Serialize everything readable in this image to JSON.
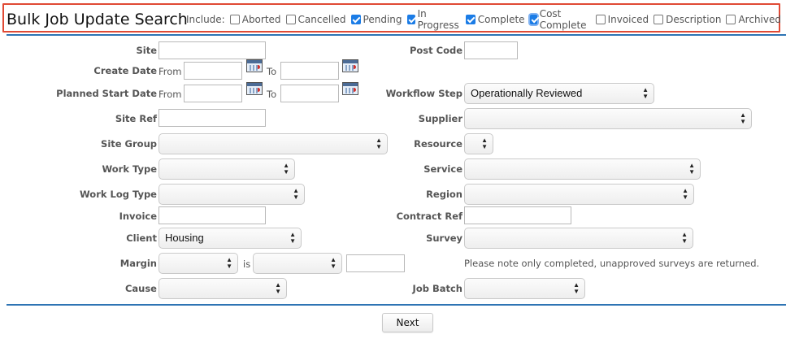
{
  "header": {
    "title": "Bulk Job Update Search",
    "include_label": "Include:",
    "filters": [
      {
        "label": "Aborted",
        "checked": false
      },
      {
        "label": "Cancelled",
        "checked": false
      },
      {
        "label": "Pending",
        "checked": true
      },
      {
        "label": "In Progress",
        "checked": true
      },
      {
        "label": "Complete",
        "checked": true
      },
      {
        "label": "Cost Complete",
        "checked": true
      },
      {
        "label": "Invoiced",
        "checked": false
      },
      {
        "label": "Description",
        "checked": false
      },
      {
        "label": "Archived",
        "checked": false
      }
    ]
  },
  "form": {
    "site": {
      "label": "Site",
      "value": ""
    },
    "post_code": {
      "label": "Post Code",
      "value": ""
    },
    "create_date": {
      "label": "Create Date",
      "from": "From",
      "to": "To",
      "from_value": "",
      "to_value": ""
    },
    "planned_start_date": {
      "label": "Planned Start Date",
      "from": "From",
      "to": "To",
      "from_value": "",
      "to_value": ""
    },
    "workflow_step": {
      "label": "Workflow Step",
      "value": "Operationally Reviewed"
    },
    "site_ref": {
      "label": "Site Ref",
      "value": ""
    },
    "supplier": {
      "label": "Supplier",
      "value": ""
    },
    "site_group": {
      "label": "Site Group",
      "value": ""
    },
    "resource": {
      "label": "Resource",
      "value": ""
    },
    "work_type": {
      "label": "Work Type",
      "value": ""
    },
    "service": {
      "label": "Service",
      "value": ""
    },
    "work_log_type": {
      "label": "Work Log Type",
      "value": ""
    },
    "region": {
      "label": "Region",
      "value": ""
    },
    "invoice": {
      "label": "Invoice",
      "value": ""
    },
    "contract_ref": {
      "label": "Contract Ref",
      "value": ""
    },
    "client": {
      "label": "Client",
      "value": "Housing"
    },
    "survey": {
      "label": "Survey",
      "value": ""
    },
    "margin": {
      "label": "Margin",
      "is": "is",
      "value": ""
    },
    "survey_note": "Please note only completed, unapproved surveys are returned.",
    "cause": {
      "label": "Cause",
      "value": ""
    },
    "job_batch": {
      "label": "Job Batch",
      "value": ""
    }
  },
  "actions": {
    "next": "Next"
  }
}
